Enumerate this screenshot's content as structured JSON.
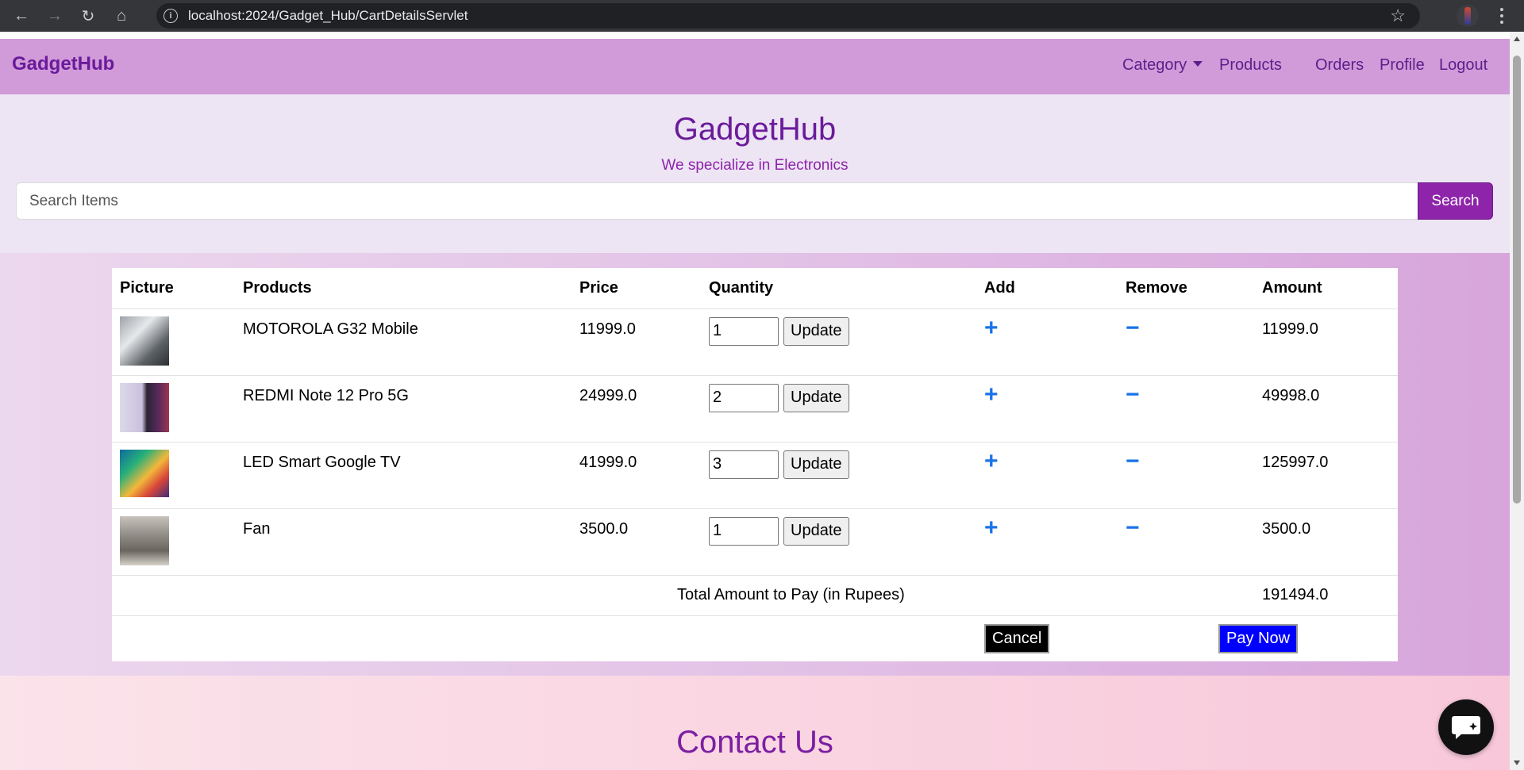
{
  "browser": {
    "url": "localhost:2024/Gadget_Hub/CartDetailsServlet"
  },
  "navbar": {
    "brand": "GadgetHub",
    "links": [
      {
        "label": "Category",
        "dropdown": true
      },
      {
        "label": "Products"
      },
      {
        "label": "Orders"
      },
      {
        "label": "Profile"
      },
      {
        "label": "Logout"
      }
    ]
  },
  "header": {
    "title": "GadgetHub",
    "tagline": "We specialize in Electronics",
    "search_placeholder": "Search Items",
    "search_button": "Search"
  },
  "cart": {
    "columns": [
      "Picture",
      "Products",
      "Price",
      "Quantity",
      "Add",
      "Remove",
      "Amount"
    ],
    "update_label": "Update",
    "items": [
      {
        "product": "MOTOROLA G32 Mobile",
        "price": "11999.0",
        "quantity": "1",
        "amount": "11999.0"
      },
      {
        "product": "REDMI Note 12 Pro 5G",
        "price": "24999.0",
        "quantity": "2",
        "amount": "49998.0"
      },
      {
        "product": "LED Smart Google TV",
        "price": "41999.0",
        "quantity": "3",
        "amount": "125997.0"
      },
      {
        "product": "Fan",
        "price": "3500.0",
        "quantity": "1",
        "amount": "3500.0"
      }
    ],
    "total_label": "Total Amount to Pay (in Rupees)",
    "total_value": "191494.0",
    "cancel_label": "Cancel",
    "pay_label": "Pay Now"
  },
  "contact": {
    "title": "Contact Us"
  },
  "colors": {
    "navbar_bg": "#d19ad9",
    "brand_purple": "#6a1b9a",
    "search_button_bg": "#8e24aa",
    "pay_button_bg": "#0000ff",
    "cancel_button_bg": "#000000",
    "icon_blue": "#1a73e8"
  }
}
